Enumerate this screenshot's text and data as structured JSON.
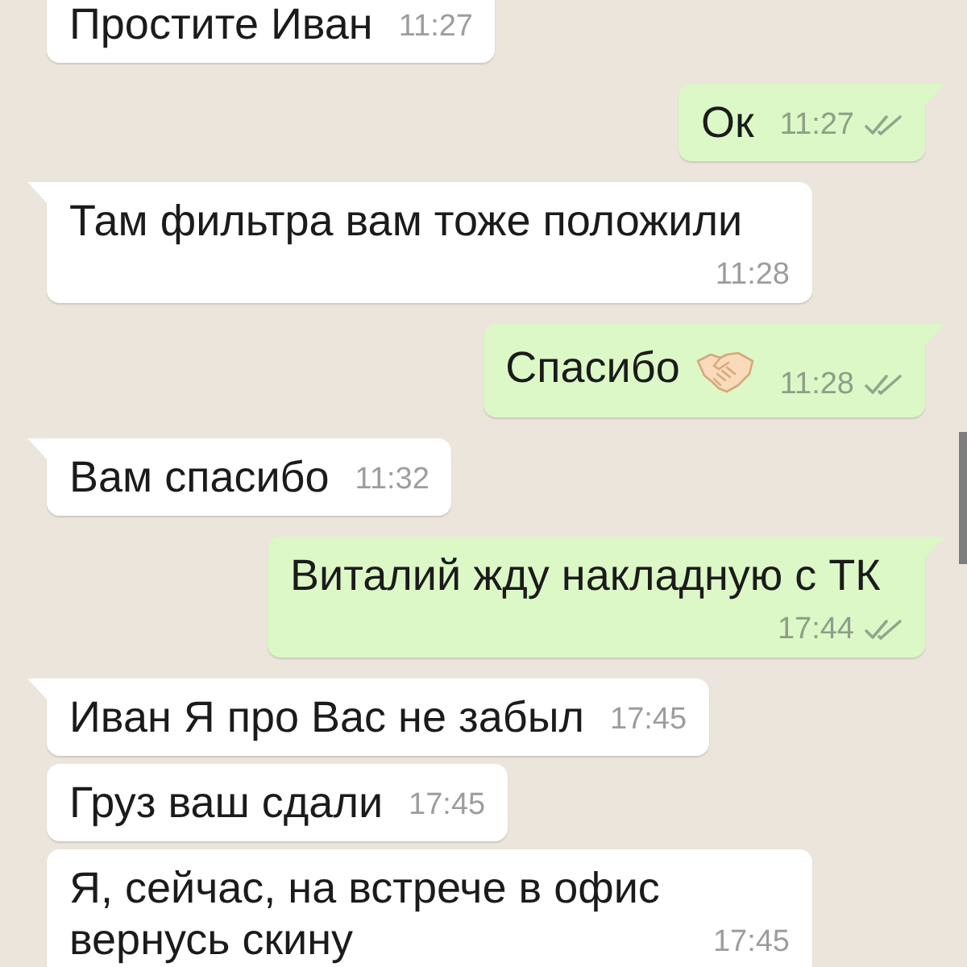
{
  "messages": [
    {
      "kind": "incoming",
      "text": "Простите Иван",
      "time": "11:27"
    },
    {
      "kind": "outgoing",
      "text": "Ок",
      "time": "11:27",
      "read": false
    },
    {
      "kind": "incoming",
      "text": "Там фильтра вам тоже положили",
      "time": "11:28"
    },
    {
      "kind": "outgoing",
      "text": "Спасибо",
      "trailing_emoji": true,
      "time": "11:28",
      "read": false
    },
    {
      "kind": "incoming",
      "text": "Вам спасибо",
      "time": "11:32"
    },
    {
      "kind": "outgoing",
      "text": "Виталий жду накладную с ТК",
      "time": "17:44",
      "read": false
    },
    {
      "kind": "incoming",
      "text": "Иван Я про Вас не забыл",
      "time": "17:45"
    },
    {
      "kind": "incoming",
      "text": "Груз ваш сдали",
      "time": "17:45"
    },
    {
      "kind": "incoming",
      "text": "Я, сейчас, на встрече в офис вернусь скину",
      "time": "17:45"
    }
  ]
}
